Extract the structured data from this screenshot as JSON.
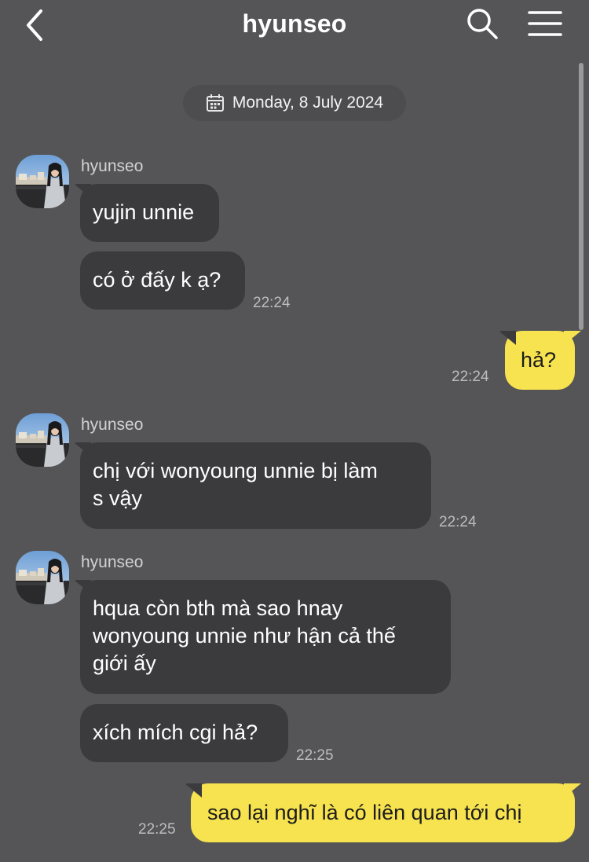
{
  "header": {
    "title": "hyunseo",
    "back_icon": "chevron-left-icon",
    "search_icon": "search-icon",
    "menu_icon": "hamburger-menu-icon"
  },
  "date_divider": {
    "label": "Monday, 8 July 2024",
    "icon": "calendar-icon"
  },
  "messages": [
    {
      "group": 1,
      "sender": "hyunseo",
      "bubbles": [
        "yujin unnie",
        "có ở đấy k ạ?"
      ],
      "time": "22:24"
    },
    {
      "group": 2,
      "mine": true,
      "bubbles": [
        "hả?"
      ],
      "time": "22:24"
    },
    {
      "group": 3,
      "sender": "hyunseo",
      "bubbles": [
        "chị với wonyoung unnie bị làm\ns vậy"
      ],
      "time": "22:24"
    },
    {
      "group": 4,
      "sender": "hyunseo",
      "bubbles": [
        "hqua còn bth mà sao hnay\nwonyoung unnie như hận cả thế\ngiới ấy",
        "xích mích cgi hả?"
      ],
      "time": "22:25"
    },
    {
      "group": 5,
      "mine": true,
      "bubbles": [
        "sao lại nghĩ là có liên quan tới chị"
      ],
      "time": "22:25"
    }
  ],
  "colors": {
    "background": "#555557",
    "incoming_bubble": "#3b3b3d",
    "outgoing_bubble": "#f7e34f"
  }
}
